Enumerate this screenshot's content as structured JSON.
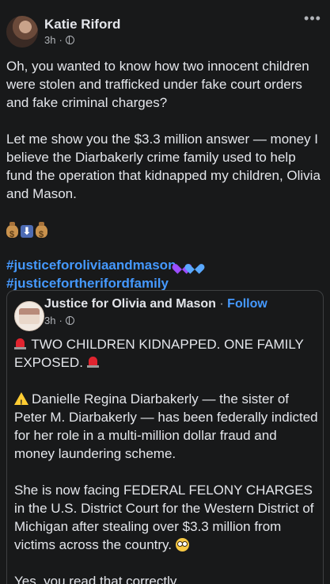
{
  "post": {
    "author": "Katie Riford",
    "time": "3h",
    "meta_sep": "·",
    "more_label": "•••",
    "paragraph1": "Oh, you wanted to know how two innocent children were stolen and trafficked under fake court orders and fake criminal charges?",
    "paragraph2": "Let me show you the $3.3 million answer — money I believe the Diarbakerly crime family used to help fund the operation that kidnapped my children, Olivia and Mason.",
    "emoji_row": [
      "money-bag",
      "down-arrow",
      "money-bag"
    ],
    "hashtag1": "#justiceforoliviaandmason",
    "hashtag2": "#justicefortherifordfamily"
  },
  "shared": {
    "page_name": "Justice for Olivia and Mason",
    "sep": " · ",
    "follow_label": "Follow",
    "time": "3h",
    "meta_sep": "·",
    "headline": "TWO CHILDREN KIDNAPPED. ONE FAMILY EXPOSED.",
    "paragraph1": "Danielle Regina Diarbakerly — the sister of Peter M. Diarbakerly — has been federally indicted for her role in a multi-million dollar fraud and money laundering scheme.",
    "paragraph2": "She is now facing FEDERAL FELONY CHARGES in the U.S. District Court for the Western District of Michigan after stealing over $3.3 million from victims across the country.",
    "paragraph3": "Yes, you read that correctly."
  },
  "colors": {
    "background": "#18191a",
    "text": "#e4e6eb",
    "secondary": "#b0b3b8",
    "link": "#4599ff"
  }
}
